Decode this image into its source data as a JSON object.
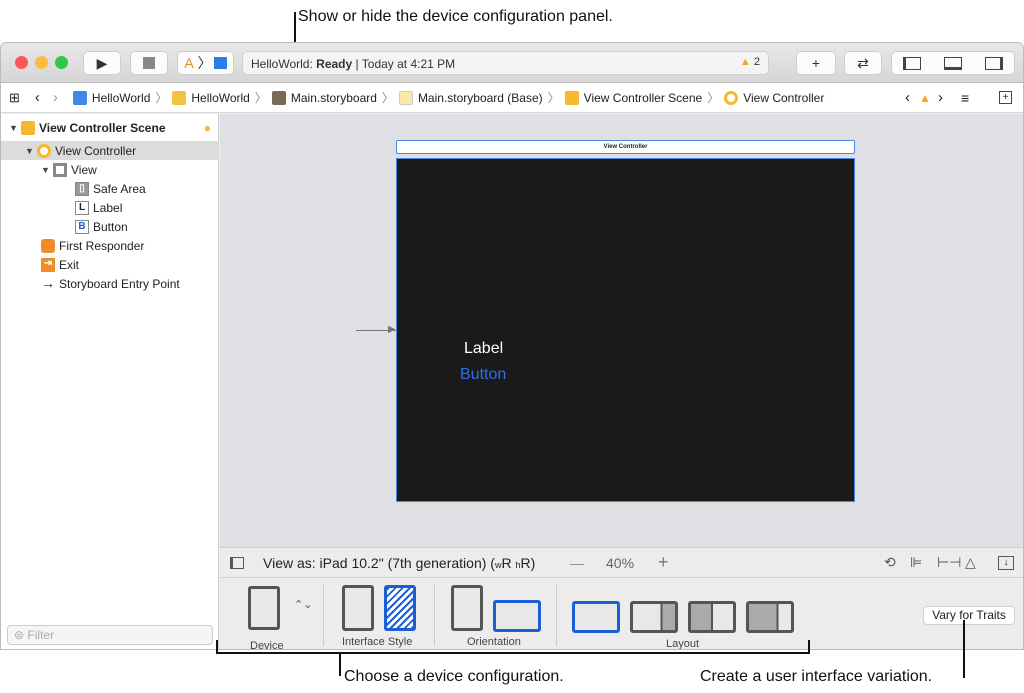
{
  "callouts": {
    "top": "Show or hide the device configuration panel.",
    "bottom_left": "Choose a device configuration.",
    "bottom_right": "Create a user interface variation."
  },
  "toolbar": {
    "status_app": "HelloWorld:",
    "status_state": "Ready",
    "status_time": "| Today at 4:21 PM",
    "warning_count": "2",
    "add": "+",
    "swap": "⇄"
  },
  "breadcrumb": [
    "HelloWorld",
    "HelloWorld",
    "Main.storyboard",
    "Main.storyboard (Base)",
    "View Controller Scene",
    "View Controller"
  ],
  "outline": {
    "scene": "View Controller Scene",
    "items": [
      {
        "label": "View Controller",
        "selected": true
      },
      {
        "label": "View"
      },
      {
        "label": "Safe Area",
        "badge": "▯"
      },
      {
        "label": "Label",
        "badge": "L"
      },
      {
        "label": "Button",
        "badge": "B"
      },
      {
        "label": "First Responder"
      },
      {
        "label": "Exit"
      },
      {
        "label": "Storyboard Entry Point"
      }
    ]
  },
  "filter": {
    "placeholder": "Filter"
  },
  "scene": {
    "title": "View Controller",
    "label": "Label",
    "button": "Button",
    "bg": "#1a1a1a",
    "button_color": "#2a6ef0"
  },
  "bottombar": {
    "view_as": "View as: iPad 10.2\" (7th generation)",
    "traits_w": "w",
    "traits_wv": "R",
    "traits_h": "h",
    "traits_hv": "R",
    "minus": "—",
    "zoom": "40%",
    "plus": "+"
  },
  "config": {
    "device": "Device",
    "interface_style": "Interface Style",
    "orientation": "Orientation",
    "layout": "Layout",
    "vary": "Vary for Traits"
  },
  "colors": {
    "accent": "#1a5fd6",
    "warning": "#f5a623"
  }
}
